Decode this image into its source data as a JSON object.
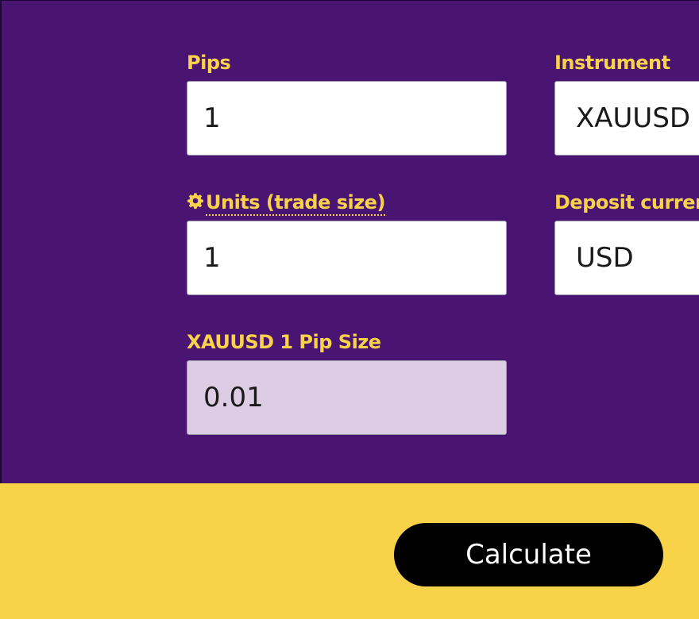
{
  "form": {
    "pips": {
      "label": "Pips",
      "value": "1"
    },
    "instrument": {
      "label": "Instrument",
      "value": "XAUUSD"
    },
    "units": {
      "label": "Units (trade size)",
      "value": "1"
    },
    "deposit_currency": {
      "label": "Deposit currer",
      "value": "USD"
    },
    "pip_size": {
      "label": "XAUUSD 1 Pip Size",
      "value": "0.01"
    }
  },
  "actions": {
    "calculate_label": "Calculate"
  },
  "colors": {
    "panel_background": "#4a1572",
    "label_text": "#f8d34a",
    "footer_background": "#f8d34a",
    "readonly_field": "#dccde4",
    "button_background": "#000000",
    "button_text": "#ffffff"
  },
  "icons": {
    "units_label_icon": "gear-icon"
  }
}
